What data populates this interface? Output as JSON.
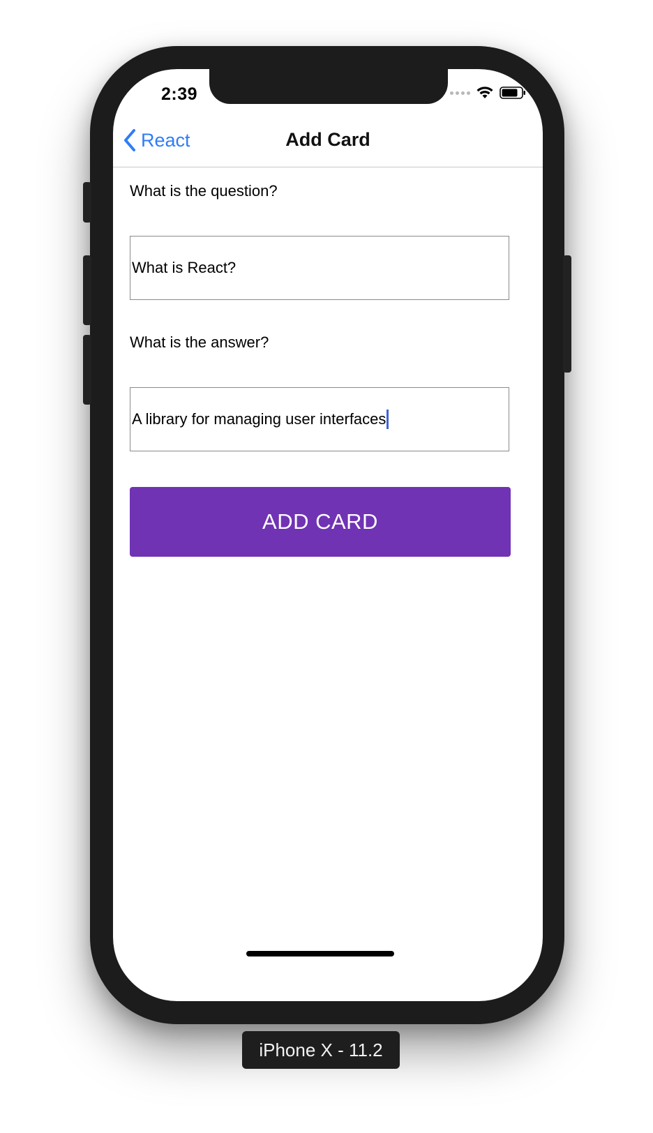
{
  "status_bar": {
    "time": "2:39"
  },
  "nav": {
    "back_label": "React",
    "title": "Add Card"
  },
  "form": {
    "question_label": "What is the question?",
    "question_value": "What is React?",
    "answer_label": "What is the answer?",
    "answer_value": "A library for managing user interfaces",
    "submit_label": "ADD CARD"
  },
  "device_caption": "iPhone X - 11.2",
  "colors": {
    "accent_blue": "#2f7cf6",
    "button_purple": "#7033b4",
    "caret_blue": "#3f63d9"
  },
  "icons": {
    "back": "chevron-left-icon",
    "signal": "cellular-signal-icon",
    "wifi": "wifi-icon",
    "battery": "battery-icon"
  }
}
